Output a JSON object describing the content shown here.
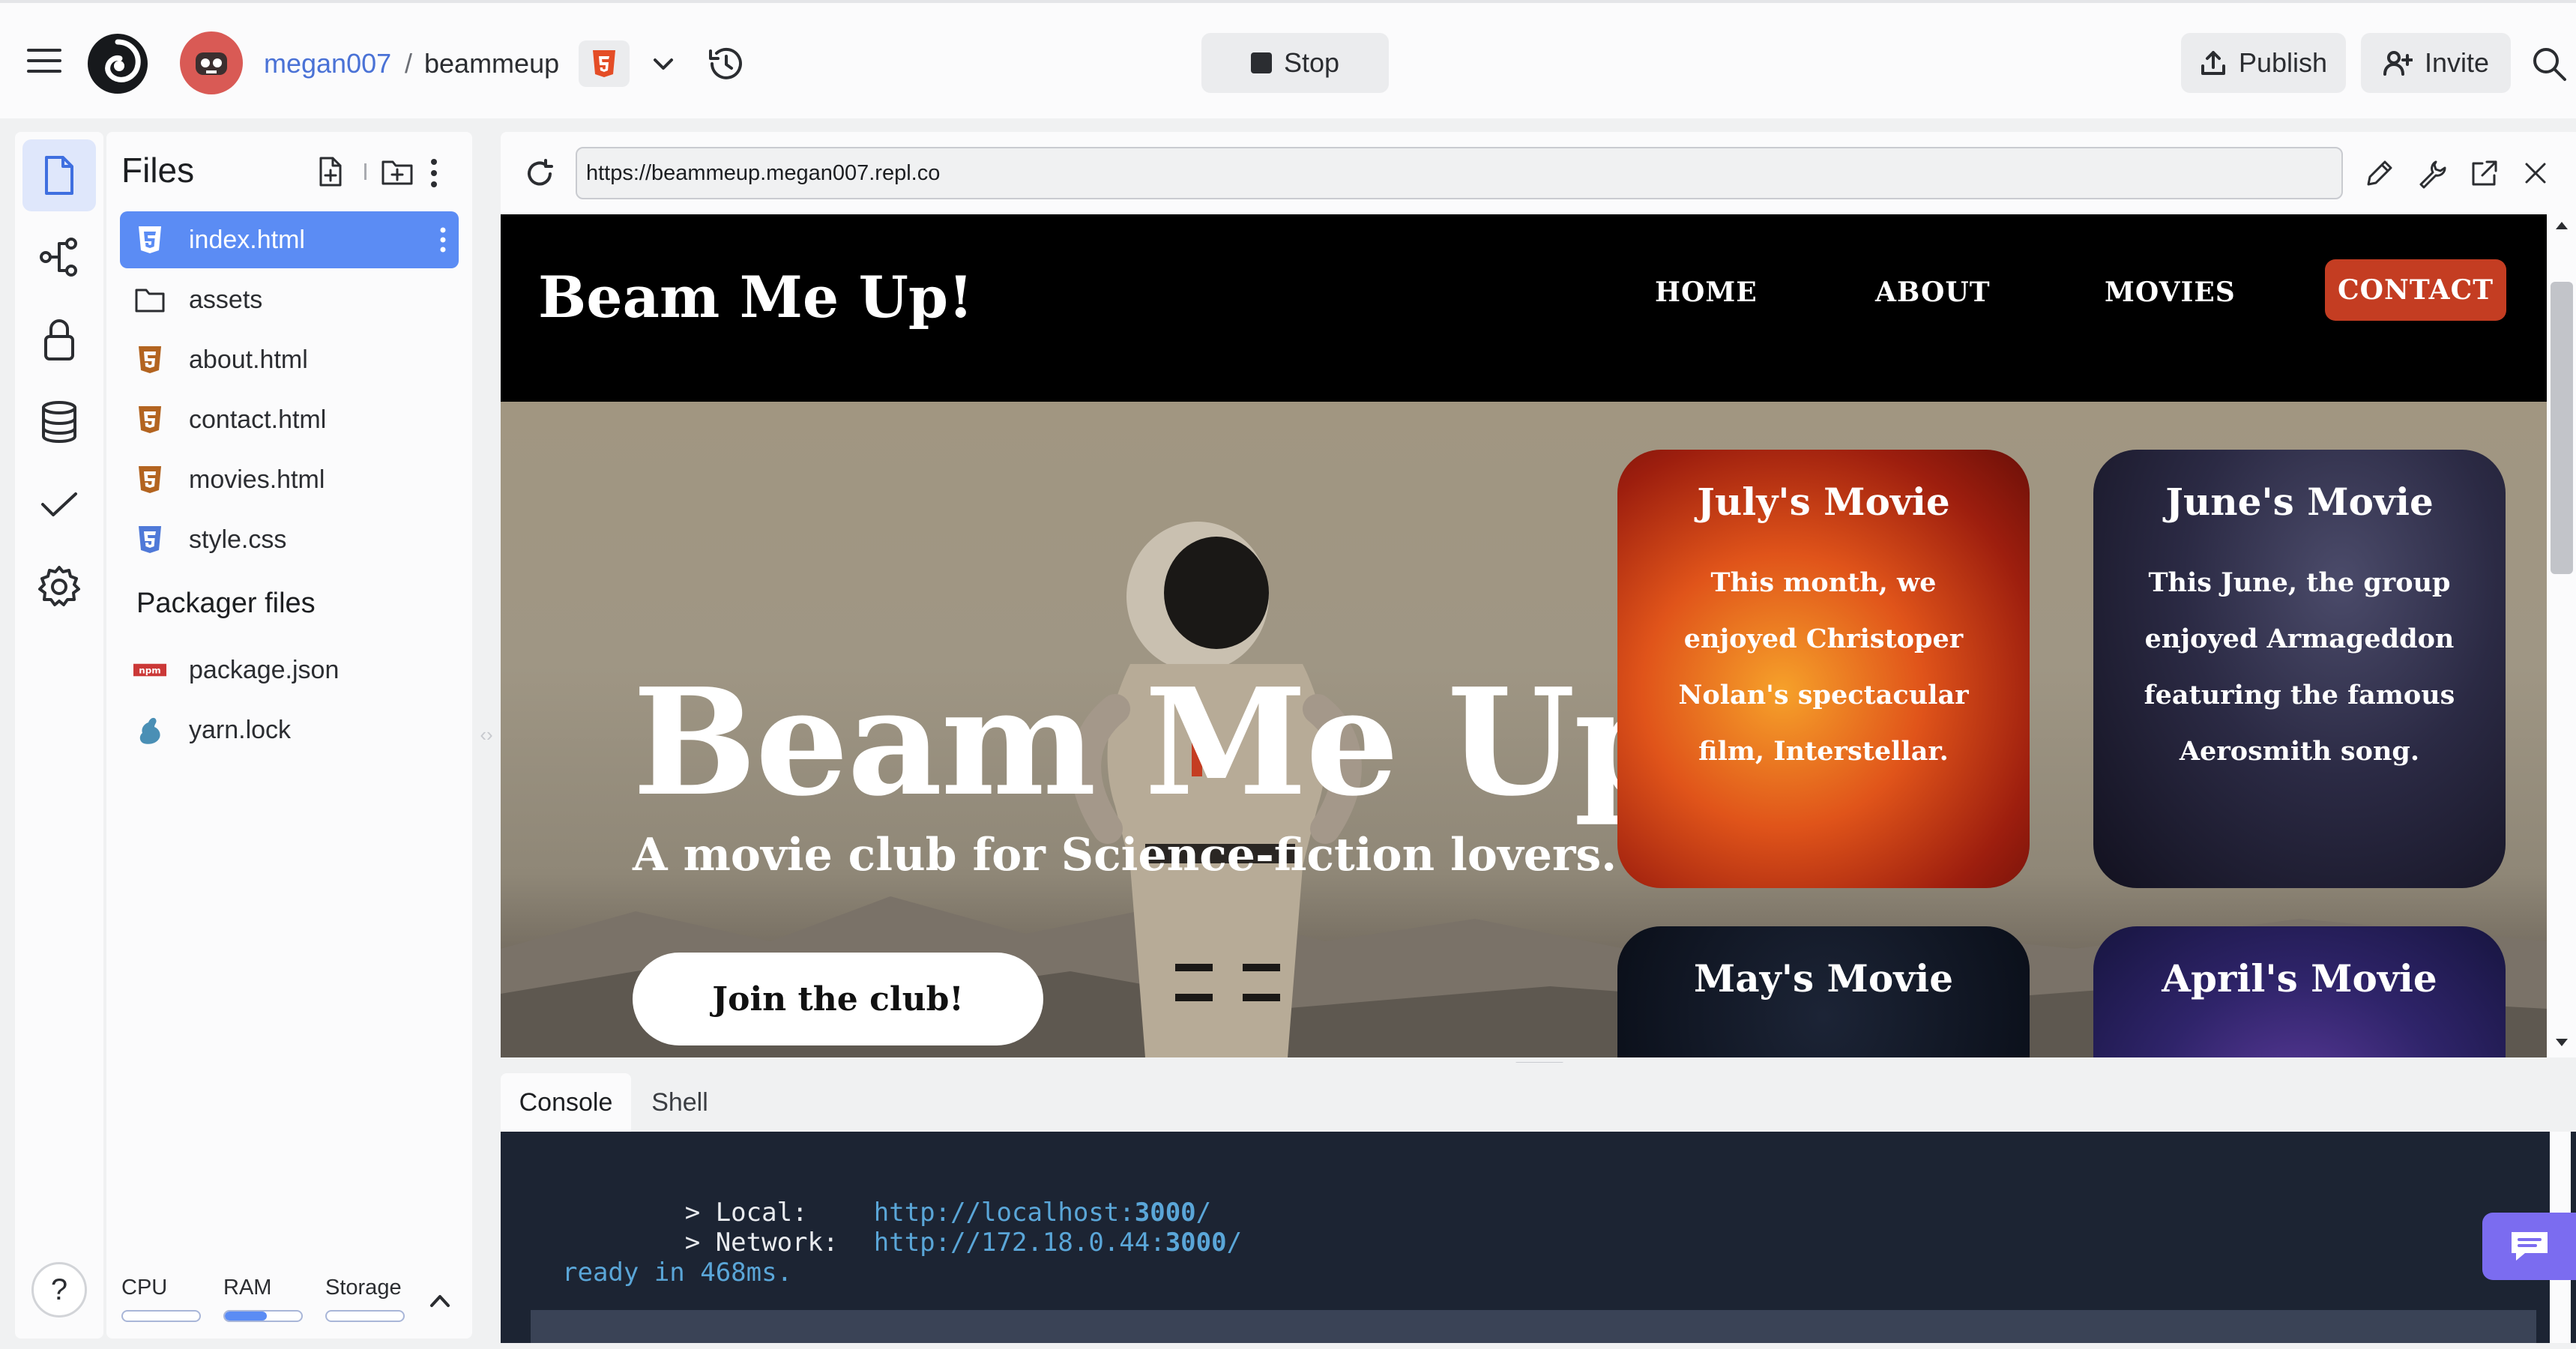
{
  "topbar": {
    "user": "megan007",
    "separator": "/",
    "repl_name": "beammeup",
    "stop_label": "Stop",
    "publish_label": "Publish",
    "invite_label": "Invite"
  },
  "files_panel": {
    "title": "Files",
    "files": [
      {
        "name": "index.html",
        "icon": "css3-icon"
      },
      {
        "name": "assets",
        "icon": "folder-icon"
      },
      {
        "name": "about.html",
        "icon": "html5-icon"
      },
      {
        "name": "contact.html",
        "icon": "html5-icon"
      },
      {
        "name": "movies.html",
        "icon": "html5-icon"
      },
      {
        "name": "style.css",
        "icon": "css3-icon"
      }
    ],
    "packager_title": "Packager files",
    "packager_files": [
      {
        "name": "package.json",
        "icon": "npm-icon"
      },
      {
        "name": "yarn.lock",
        "icon": "yarn-icon"
      }
    ],
    "resources": {
      "cpu_label": "CPU",
      "ram_label": "RAM",
      "storage_label": "Storage",
      "cpu_level": 0.0,
      "ram_level": 0.55,
      "storage_level": 0.0
    },
    "help_label": "?"
  },
  "preview": {
    "url": "https://beammeup.megan007.repl.co"
  },
  "site": {
    "logo": "Beam Me Up!",
    "nav": [
      "HOME",
      "ABOUT",
      "MOVIES",
      "CONTACT"
    ],
    "hero_title": "Beam Me Up!",
    "hero_subtitle": "A movie club for Science-fiction lovers.",
    "cta_label": "Join the club!",
    "cards": [
      {
        "title": "July's Movie",
        "lines": [
          "This month, we",
          "enjoyed Christoper",
          "Nolan's spectacular",
          "film, Interstellar."
        ]
      },
      {
        "title": "June's Movie",
        "lines": [
          "This June, the group",
          "enjoyed Armageddon",
          "featuring the famous",
          "Aerosmith song."
        ]
      },
      {
        "title": "May's Movie",
        "lines": []
      },
      {
        "title": "April's Movie",
        "lines": []
      }
    ]
  },
  "bottom": {
    "tabs": [
      "Console",
      "Shell"
    ],
    "console_lines": {
      "local_label": "> Local:",
      "local_url_prefix": "http://localhost:",
      "local_port": "3000",
      "local_suffix": "/",
      "network_label": "> Network:",
      "network_url_prefix": "http://172.18.0.44:",
      "network_port": "3000",
      "network_suffix": "/",
      "ready": "ready in 468ms."
    }
  },
  "colors": {
    "accent_blue": "#5b8cf4",
    "contact_button": "#c43d22",
    "console_bg": "#1c2433",
    "chat_button": "#7b6cf0"
  }
}
